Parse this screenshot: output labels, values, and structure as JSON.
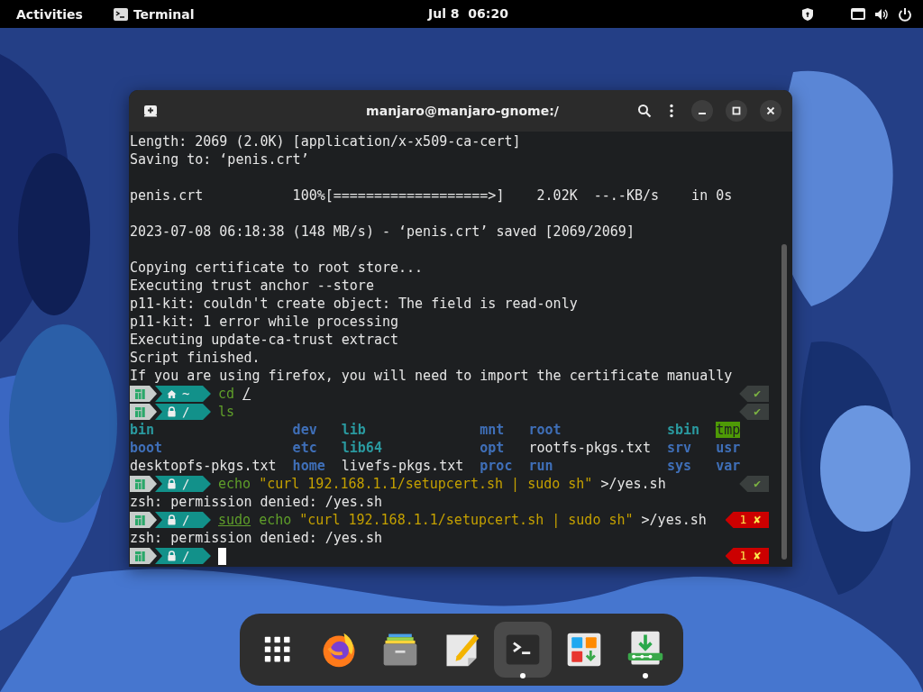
{
  "top_bar": {
    "activities": "Activities",
    "app_name": "Terminal",
    "clock": "Jul 8  06:20"
  },
  "terminal": {
    "title": "manjaro@manjaro-gnome:/",
    "lines": [
      {
        "kind": "text",
        "text": "Length: 2069 (2.0K) [application/x-x509-ca-cert]"
      },
      {
        "kind": "text",
        "text": "Saving to: ‘penis.crt’"
      },
      {
        "kind": "blank"
      },
      {
        "kind": "text",
        "text": "penis.crt           100%[===================>]    2.02K  --.-KB/s    in 0s"
      },
      {
        "kind": "blank"
      },
      {
        "kind": "text",
        "text": "2023-07-08 06:18:38 (148 MB/s) - ‘penis.crt’ saved [2069/2069]"
      },
      {
        "kind": "blank"
      },
      {
        "kind": "text",
        "text": "Copying certificate to root store..."
      },
      {
        "kind": "text",
        "text": "Executing trust anchor --store"
      },
      {
        "kind": "text",
        "text": "p11-kit: couldn't create object: The field is read-only"
      },
      {
        "kind": "text",
        "text": "p11-kit: 1 error while processing"
      },
      {
        "kind": "text",
        "text": "Executing update-ca-trust extract"
      },
      {
        "kind": "text",
        "text": "Script finished."
      },
      {
        "kind": "text",
        "text": "If you are using firefox, you will need to import the certificate manually"
      },
      {
        "kind": "prompt",
        "segment": {
          "kind": "home",
          "path": "~"
        },
        "tokens": [
          {
            "text": "cd",
            "kind": "command",
            "underline": false
          },
          {
            "text": "/",
            "kind": "plain",
            "underline": true
          }
        ],
        "status": {
          "kind": "ok",
          "text": "✔"
        }
      },
      {
        "kind": "prompt",
        "segment": {
          "kind": "lock",
          "path": "/"
        },
        "tokens": [
          {
            "text": "ls",
            "kind": "command",
            "underline": false
          }
        ],
        "status": {
          "kind": "ok",
          "text": "✔"
        }
      },
      {
        "kind": "listing",
        "rows": [
          [
            {
              "name": "bin",
              "kind": "link"
            },
            {
              "name": "dev",
              "kind": "dir"
            },
            {
              "name": "lib",
              "kind": "link"
            },
            {
              "name": "mnt",
              "kind": "dir"
            },
            {
              "name": "root",
              "kind": "dir"
            },
            {
              "name": "sbin",
              "kind": "link"
            },
            {
              "name": "tmp",
              "kind": "sticky"
            }
          ],
          [
            {
              "name": "boot",
              "kind": "dir"
            },
            {
              "name": "etc",
              "kind": "dir"
            },
            {
              "name": "lib64",
              "kind": "link"
            },
            {
              "name": "opt",
              "kind": "dir"
            },
            {
              "name": "rootfs-pkgs.txt",
              "kind": "file"
            },
            {
              "name": "srv",
              "kind": "dir"
            },
            {
              "name": "usr",
              "kind": "dir"
            }
          ],
          [
            {
              "name": "desktopfs-pkgs.txt",
              "kind": "file"
            },
            {
              "name": "home",
              "kind": "dir"
            },
            {
              "name": "livefs-pkgs.txt",
              "kind": "file"
            },
            {
              "name": "proc",
              "kind": "dir"
            },
            {
              "name": "run",
              "kind": "dir"
            },
            {
              "name": "sys",
              "kind": "dir"
            },
            {
              "name": "var",
              "kind": "dir"
            }
          ]
        ]
      },
      {
        "kind": "prompt",
        "segment": {
          "kind": "lock",
          "path": "/"
        },
        "tokens": [
          {
            "text": "echo",
            "kind": "command",
            "underline": false
          },
          {
            "text": "\"curl 192.168.1.1/setupcert.sh | sudo sh\"",
            "kind": "string",
            "underline": false
          },
          {
            "text": ">/yes.sh",
            "kind": "plain",
            "underline": false
          }
        ],
        "status": {
          "kind": "ok",
          "text": "✔"
        }
      },
      {
        "kind": "text",
        "text": "zsh: permission denied: /yes.sh"
      },
      {
        "kind": "prompt",
        "segment": {
          "kind": "lock",
          "path": "/"
        },
        "tokens": [
          {
            "text": "sudo",
            "kind": "command",
            "underline": true
          },
          {
            "text": "echo",
            "kind": "command",
            "underline": false
          },
          {
            "text": "\"curl 192.168.1.1/setupcert.sh | sudo sh\"",
            "kind": "string",
            "underline": false
          },
          {
            "text": ">/yes.sh",
            "kind": "plain",
            "underline": false
          }
        ],
        "status": {
          "kind": "error",
          "text": "1 ✘"
        }
      },
      {
        "kind": "text",
        "text": "zsh: permission denied: /yes.sh"
      },
      {
        "kind": "prompt",
        "segment": {
          "kind": "lock",
          "path": "/"
        },
        "cursor": true,
        "status": {
          "kind": "error",
          "text": "1 ✘"
        }
      }
    ]
  },
  "dock": [
    {
      "kind": "apps",
      "selected": false,
      "running": false
    },
    {
      "kind": "browser",
      "selected": false,
      "running": false
    },
    {
      "kind": "files",
      "selected": false,
      "running": false
    },
    {
      "kind": "editor",
      "selected": false,
      "running": false
    },
    {
      "kind": "terminal",
      "selected": true,
      "running": true
    },
    {
      "kind": "software",
      "selected": false,
      "running": false
    },
    {
      "kind": "installer",
      "selected": false,
      "running": true
    }
  ]
}
